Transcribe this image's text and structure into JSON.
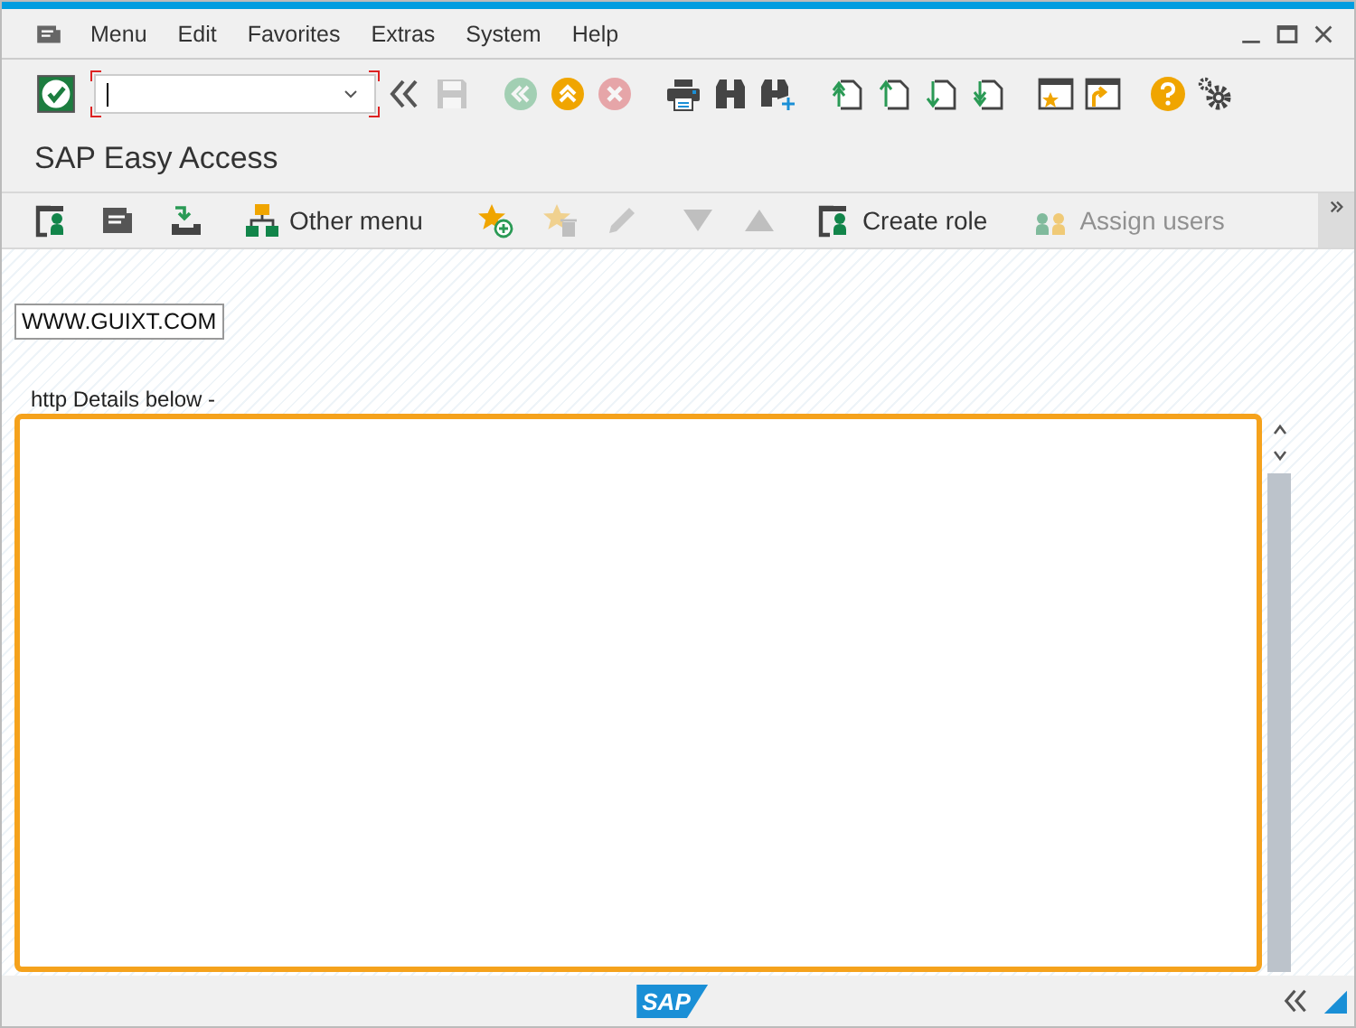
{
  "menu": [
    {
      "label": "Menu"
    },
    {
      "label": "Edit"
    },
    {
      "label": "Favorites"
    },
    {
      "label": "Extras"
    },
    {
      "label": "System"
    },
    {
      "label": "Help"
    }
  ],
  "toolbar": [
    {
      "kind": "enter",
      "disabled": false
    },
    {
      "kind": "field"
    },
    {
      "kind": "collapse",
      "disabled": false
    },
    {
      "kind": "save",
      "disabled": true
    },
    {
      "kind": "back",
      "disabled": true
    },
    {
      "kind": "exit",
      "disabled": false
    },
    {
      "kind": "cancel",
      "disabled": true
    },
    {
      "kind": "print",
      "disabled": false
    },
    {
      "kind": "find",
      "disabled": false
    },
    {
      "kind": "find_next",
      "disabled": false
    },
    {
      "kind": "first_page",
      "disabled": false
    },
    {
      "kind": "previous_page",
      "disabled": false
    },
    {
      "kind": "next_page",
      "disabled": false
    },
    {
      "kind": "last_page",
      "disabled": false
    },
    {
      "kind": "new_session",
      "disabled": false
    },
    {
      "kind": "shortcut",
      "disabled": false
    },
    {
      "kind": "help",
      "disabled": false
    },
    {
      "kind": "settings",
      "disabled": false
    }
  ],
  "title": "SAP Easy Access",
  "app_toolbar": [
    {
      "kind": "role",
      "disabled": false
    },
    {
      "kind": "menu",
      "disabled": false
    },
    {
      "kind": "download",
      "disabled": false
    },
    {
      "kind": "org",
      "label": "Other menu",
      "disabled": false
    },
    {
      "kind": "add_favorite",
      "disabled": false
    },
    {
      "kind": "delete_favorite",
      "disabled": true
    },
    {
      "kind": "edit",
      "disabled": true
    },
    {
      "kind": "move_down",
      "disabled": true
    },
    {
      "kind": "move_up",
      "disabled": true
    },
    {
      "kind": "role",
      "label": "Create role",
      "disabled": false
    },
    {
      "kind": "users",
      "label": "Assign users",
      "disabled": true
    }
  ],
  "button": "WWW.GUIXT.COM",
  "text_label": "http Details below -",
  "status_bar": {
    "logo": "SAP"
  }
}
